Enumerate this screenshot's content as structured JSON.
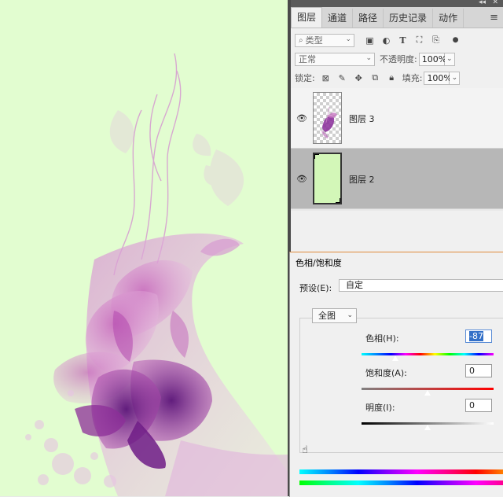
{
  "panel": {
    "tabs": [
      "图层",
      "通道",
      "路径",
      "历史记录",
      "动作"
    ],
    "active_tab": 0,
    "filter": {
      "label": "类型"
    },
    "blend_mode": "正常",
    "opacity_label": "不透明度:",
    "opacity_value": "100%",
    "lock_label": "锁定:",
    "fill_label": "填充:",
    "fill_value": "100%",
    "layers": [
      {
        "name": "图层 3",
        "visible": true,
        "selected": false,
        "thumb": "transparent-flower"
      },
      {
        "name": "图层 2",
        "visible": true,
        "selected": true,
        "thumb": "solid",
        "thumb_color": "#d3f7b8"
      }
    ],
    "icons": {
      "search": "search-icon",
      "filter_pixel": "image-filter-icon",
      "filter_adjust": "adjustment-filter-icon",
      "filter_type": "text-filter-icon",
      "filter_shape": "shape-filter-icon",
      "filter_smart": "smart-object-filter-icon",
      "filter_toggle": "filter-toggle-icon",
      "lock_transparent": "lock-transparent-icon",
      "lock_image": "lock-brush-icon",
      "lock_position": "lock-move-icon",
      "lock_artboard": "lock-artboard-icon",
      "lock_all": "lock-all-icon",
      "eye": "eye-icon",
      "menu": "menu-icon"
    }
  },
  "dialog": {
    "title": "色相/饱和度",
    "preset_label": "预设(E):",
    "preset_value": "自定",
    "channel": "全图",
    "hue": {
      "label": "色相(H):",
      "value": "-87",
      "level": -87
    },
    "saturation": {
      "label": "饱和度(A):",
      "value": "0",
      "level": 0
    },
    "lightness": {
      "label": "明度(I):",
      "value": "0",
      "level": 0
    }
  },
  "colors": {
    "canvas_bg": "#e2fdd0",
    "layer_fill": "#d3f7b8",
    "selected_row": "#b7b7b7",
    "dialog_accent": "#e08a3a",
    "flower_dark": "#6e1c86",
    "flower_mid": "#a53fa6",
    "flower_light": "#d79ad2"
  }
}
